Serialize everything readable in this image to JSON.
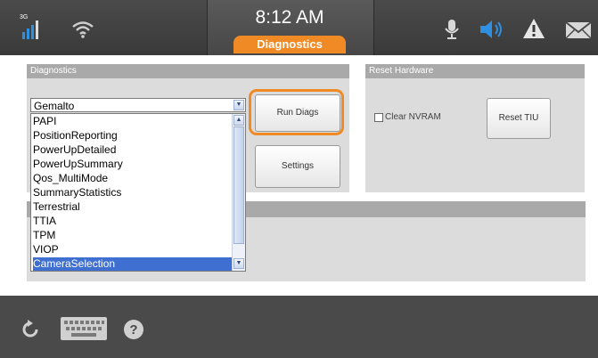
{
  "status_bar": {
    "network_type": "3G",
    "time": "8:12 AM",
    "active_tab": "Diagnostics"
  },
  "diagnostics": {
    "header": "Diagnostics",
    "selected_value": "Gemalto",
    "options": [
      "PAPI",
      "PositionReporting",
      "PowerUpDetailed",
      "PowerUpSummary",
      "Qos_MultiMode",
      "SummaryStatistics",
      "Terrestrial",
      "TTIA",
      "TPM",
      "VIOP",
      "CameraSelection"
    ],
    "highlighted_option": "CameraSelection",
    "run_button": "Run Diags",
    "settings_button": "Settings"
  },
  "reset_hardware": {
    "header": "Reset Hardware",
    "clear_nvram_label": "Clear NVRAM",
    "clear_nvram_checked": false,
    "reset_button": "Reset TIU"
  },
  "icons": {
    "signal": "signal-bars-icon",
    "wifi": "wifi-icon",
    "microphone": "microphone-icon",
    "speaker": "speaker-icon",
    "alert": "warning-icon",
    "mail": "envelope-icon",
    "refresh": "refresh-icon",
    "keyboard": "keyboard-icon",
    "help": "help-icon"
  },
  "colors": {
    "accent_orange": "#f08a24",
    "speaker_blue": "#2f8fe0",
    "selection_blue": "#3f6fd0"
  }
}
